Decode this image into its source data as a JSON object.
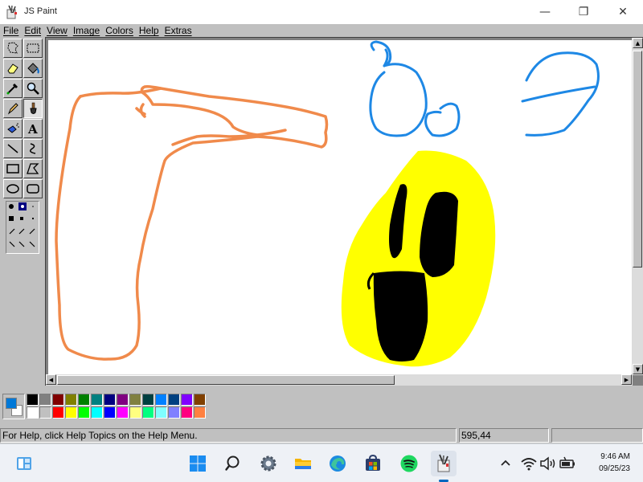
{
  "window": {
    "title": "JS Paint",
    "minimize": "—",
    "maximize": "❐",
    "close": "✕"
  },
  "menu": [
    "File",
    "Edit",
    "View",
    "Image",
    "Colors",
    "Help",
    "Extras"
  ],
  "tools": [
    {
      "name": "free-form-select"
    },
    {
      "name": "select"
    },
    {
      "name": "eraser"
    },
    {
      "name": "fill-with-color"
    },
    {
      "name": "pick-color"
    },
    {
      "name": "magnifier"
    },
    {
      "name": "pencil"
    },
    {
      "name": "brush"
    },
    {
      "name": "airbrush"
    },
    {
      "name": "text"
    },
    {
      "name": "line"
    },
    {
      "name": "curve"
    },
    {
      "name": "rectangle"
    },
    {
      "name": "polygon"
    },
    {
      "name": "ellipse"
    },
    {
      "name": "rounded-rectangle"
    }
  ],
  "active_tool": "brush",
  "palette": {
    "foreground": "#0078d7",
    "background": "#ffffff",
    "row1": [
      "#000000",
      "#808080",
      "#800000",
      "#808000",
      "#008000",
      "#008080",
      "#000080",
      "#800080",
      "#808040",
      "#004040",
      "#0080ff",
      "#004080",
      "#8000ff",
      "#804000"
    ],
    "row2": [
      "#ffffff",
      "#c0c0c0",
      "#ff0000",
      "#ffff00",
      "#00ff00",
      "#00ffff",
      "#0000ff",
      "#ff00ff",
      "#ffff80",
      "#00ff80",
      "#80ffff",
      "#8080ff",
      "#ff0080",
      "#ff8040"
    ]
  },
  "drawing_colors": {
    "orange": "#f08a4b",
    "blue": "#1e88e5",
    "yellow": "#ffff00",
    "black": "#000000"
  },
  "status": {
    "help": "For Help, click Help Topics on the Help Menu.",
    "position": "595,44",
    "size": ""
  },
  "taskbar": {
    "icons": [
      "widgets",
      "start",
      "search",
      "settings",
      "file-explorer",
      "edge",
      "store",
      "spotify",
      "js-paint"
    ],
    "time": "9:46 AM",
    "date": "09/25/23"
  }
}
